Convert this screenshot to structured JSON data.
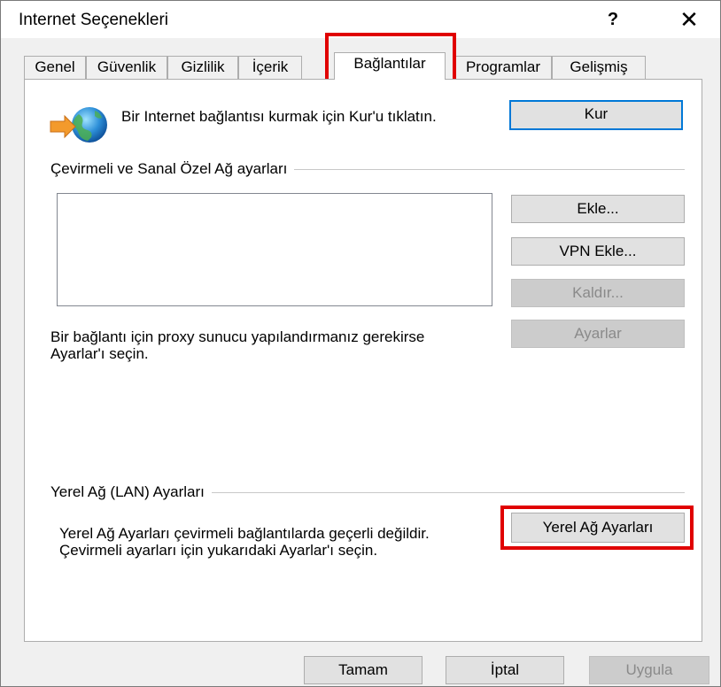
{
  "window": {
    "title": "Internet Seçenekleri",
    "help_glyph": "?",
    "close_glyph": "✕"
  },
  "tabs": [
    {
      "label": "Genel"
    },
    {
      "label": "Güvenlik"
    },
    {
      "label": "Gizlilik"
    },
    {
      "label": "İçerik"
    },
    {
      "label": "Bağlantılar",
      "active": true
    },
    {
      "label": "Programlar"
    },
    {
      "label": "Gelişmiş"
    }
  ],
  "setup": {
    "text": "Bir Internet bağlantısı kurmak için Kur'u tıklatın.",
    "button": "Kur"
  },
  "dialup": {
    "section_label": "Çevirmeli ve Sanal Özel Ağ ayarları",
    "add_button": "Ekle...",
    "add_vpn_button": "VPN Ekle...",
    "remove_button": "Kaldır...",
    "settings_button": "Ayarlar",
    "proxy_text": "Bir bağlantı için proxy sunucu yapılandırmanız gerekirse Ayarlar'ı seçin."
  },
  "lan": {
    "section_label": "Yerel Ağ (LAN) Ayarları",
    "text": "Yerel Ağ Ayarları çevirmeli bağlantılarda geçerli değildir. Çevirmeli ayarları için yukarıdaki Ayarlar'ı seçin.",
    "button": "Yerel Ağ Ayarları"
  },
  "footer": {
    "ok": "Tamam",
    "cancel": "İptal",
    "apply": "Uygula"
  },
  "colors": {
    "highlight": "#e00000",
    "focus_border": "#0078d7"
  }
}
